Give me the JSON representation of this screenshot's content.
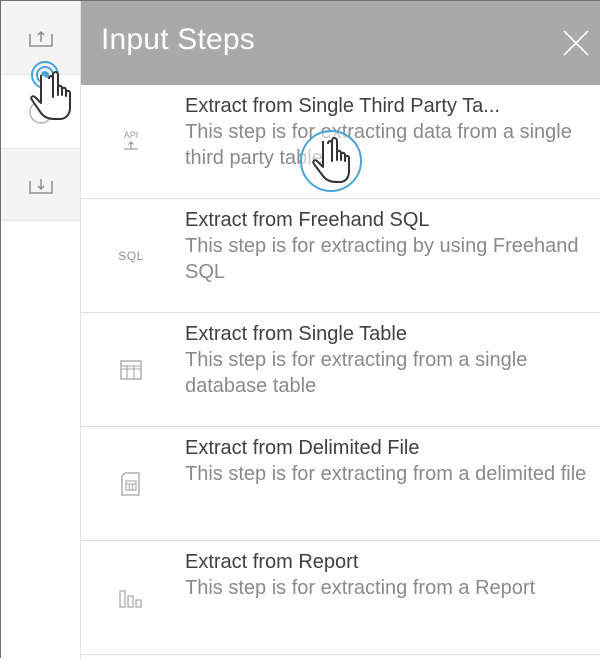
{
  "panel": {
    "title": "Input Steps"
  },
  "rail": {
    "buttons": [
      {
        "icon": "upload-tray-icon"
      },
      {
        "icon": "touch-cursor-icon"
      },
      {
        "icon": "download-tray-icon"
      }
    ]
  },
  "steps": [
    {
      "title": "Extract from Single Third Party Ta...",
      "description": "This step is for extracting data from a single third party table",
      "icon": "api-icon",
      "icon_text": "API"
    },
    {
      "title": "Extract from Freehand SQL",
      "description": "This step is for extracting by using Freehand SQL",
      "icon": "sql-icon",
      "icon_text": "SQL"
    },
    {
      "title": "Extract from Single Table",
      "description": "This step is for extracting from a single database table",
      "icon": "table-icon"
    },
    {
      "title": "Extract from Delimited File",
      "description": "This step is for extracting from a delimited file",
      "icon": "delimited-file-icon"
    },
    {
      "title": "Extract from Report",
      "description": "This step is for extracting from a Report",
      "icon": "report-chart-icon"
    }
  ],
  "colors": {
    "header_bg": "#a9a9a9",
    "title_text": "#404040",
    "desc_text": "#8a8a8a",
    "cursor_accent": "#4aa3d8"
  }
}
